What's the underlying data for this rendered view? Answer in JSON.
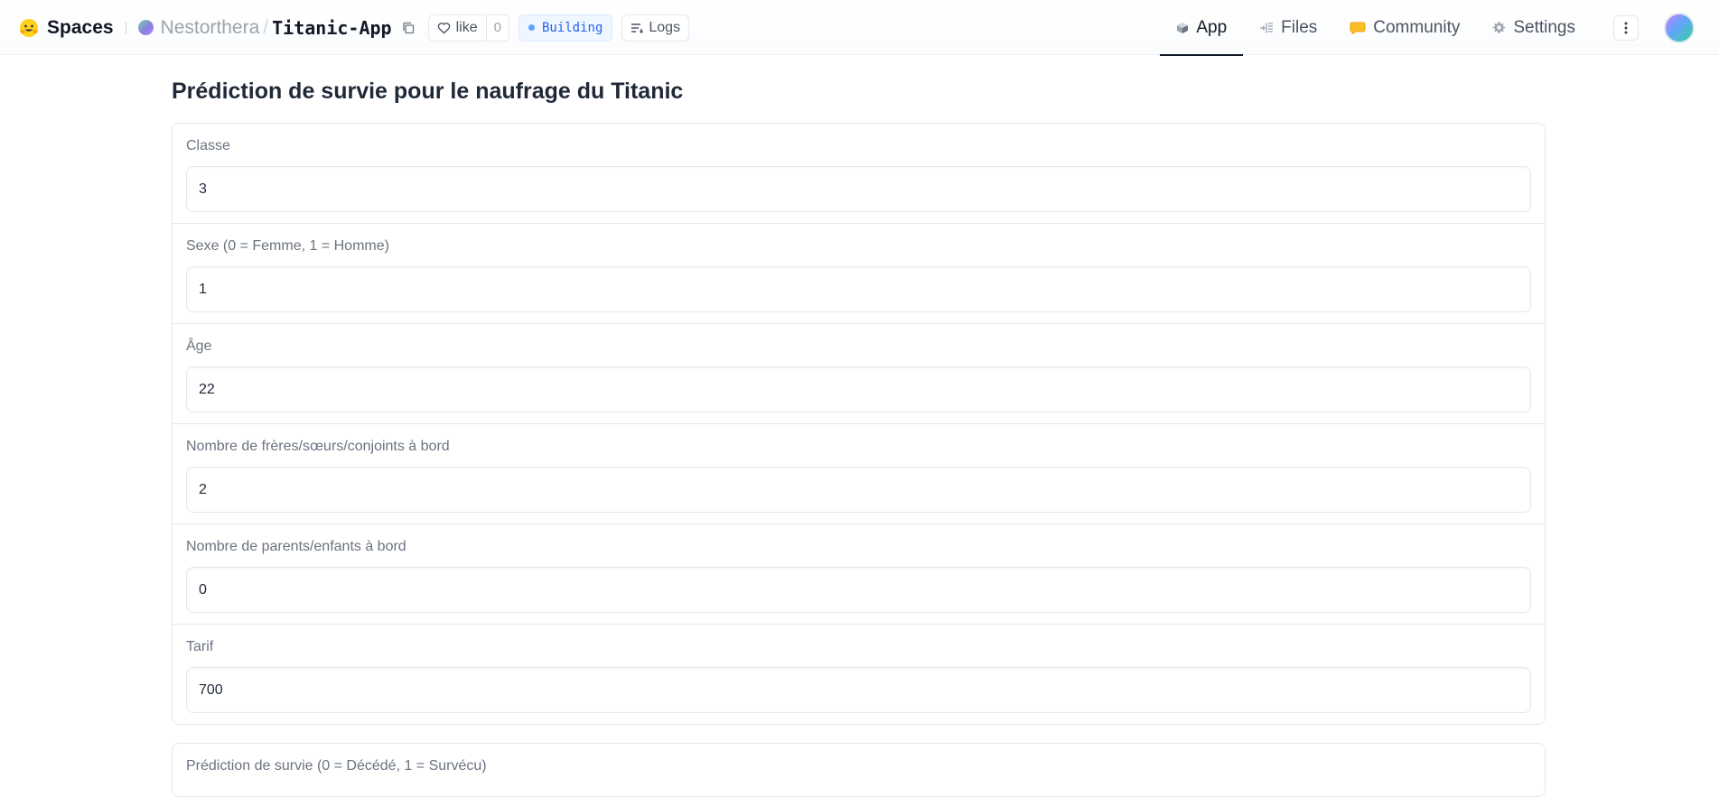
{
  "header": {
    "brand_label": "Spaces",
    "owner": "Nestorthera",
    "separator": "/",
    "repo": "Titanic-App",
    "like_label": "like",
    "like_count": "0",
    "status": "Building",
    "logs_label": "Logs",
    "tabs": [
      {
        "label": "App",
        "icon": "cube-icon",
        "active": true
      },
      {
        "label": "Files",
        "icon": "files-icon",
        "active": false
      },
      {
        "label": "Community",
        "icon": "community-icon",
        "active": false
      },
      {
        "label": "Settings",
        "icon": "gear-icon",
        "active": false
      }
    ]
  },
  "main": {
    "title": "Prédiction de survie pour le naufrage du Titanic",
    "fields": [
      {
        "label": "Classe",
        "value": "3"
      },
      {
        "label": "Sexe (0 = Femme, 1 = Homme)",
        "value": "1"
      },
      {
        "label": "Âge",
        "value": "22"
      },
      {
        "label": "Nombre de frères/sœurs/conjoints à bord",
        "value": "2"
      },
      {
        "label": "Nombre de parents/enfants à bord",
        "value": "0"
      },
      {
        "label": "Tarif",
        "value": "700"
      }
    ],
    "output_label": "Prédiction de survie (0 = Décédé, 1 = Survécu)"
  },
  "colors": {
    "accent": "#2563eb",
    "status_bg": "#eff6ff",
    "community_icon": "#fbbf24",
    "border": "#e5e7eb"
  }
}
